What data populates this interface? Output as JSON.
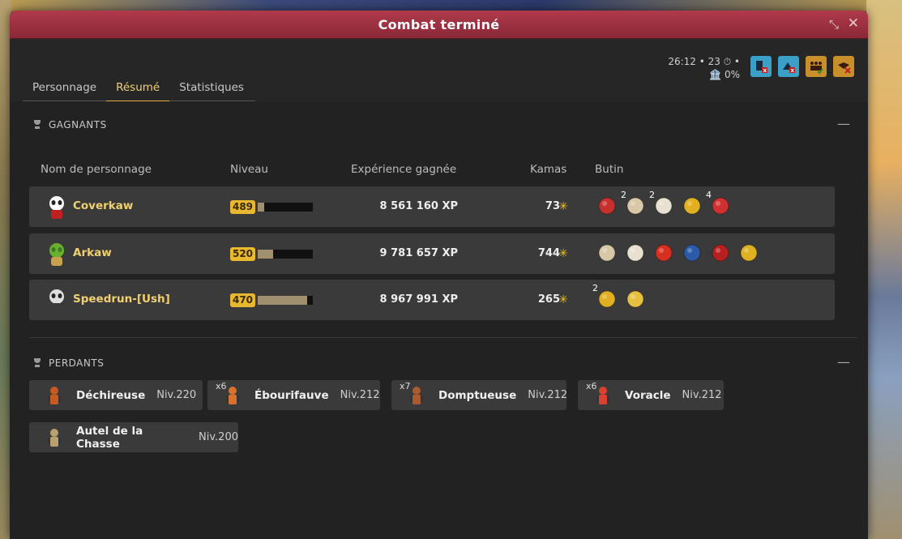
{
  "window": {
    "title": "Combat terminé"
  },
  "tabs": [
    {
      "label": "Personnage"
    },
    {
      "label": "Résumé"
    },
    {
      "label": "Statistiques"
    }
  ],
  "fight_info": {
    "line1": "26:12 • 23 ⏱ •",
    "line2": "🏦 0%"
  },
  "options": [
    {
      "icon": "spectator-lock-icon",
      "color": "#3aa0c8"
    },
    {
      "icon": "no-help-icon",
      "color": "#3aa0c8"
    },
    {
      "icon": "group-only-icon",
      "color": "#c8902a"
    },
    {
      "icon": "no-challenge-icon",
      "color": "#c8902a"
    }
  ],
  "winners": {
    "heading": "GAGNANTS",
    "columns": {
      "name": "Nom de personnage",
      "level": "Niveau",
      "xp": "Expérience gagnée",
      "kamas": "Kamas",
      "loot": "Butin"
    },
    "rows": [
      {
        "name": "Coverkaw",
        "level": "489",
        "level_progress": 0.12,
        "xp": "8 561 160 XP",
        "kamas": "73",
        "loot": [
          {
            "icon": "red-scale-icon",
            "qty": "",
            "color": "#c83030"
          },
          {
            "icon": "feather-fan-icon",
            "qty": "2",
            "color": "#d8c8a8"
          },
          {
            "icon": "paper-scroll-icon",
            "qty": "2",
            "color": "#e8e0d0"
          },
          {
            "icon": "gold-orb-icon",
            "qty": "",
            "color": "#e0b020"
          },
          {
            "icon": "red-dragon-icon",
            "qty": "4",
            "color": "#d03030"
          }
        ]
      },
      {
        "name": "Arkaw",
        "level": "520",
        "level_progress": 0.28,
        "xp": "9 781 657 XP",
        "kamas": "744",
        "loot": [
          {
            "icon": "feather-fan-icon",
            "qty": "",
            "color": "#d8c8a8"
          },
          {
            "icon": "paper-scroll-icon",
            "qty": "",
            "color": "#e8e0d0"
          },
          {
            "icon": "red-apple-icon",
            "qty": "",
            "color": "#d83020"
          },
          {
            "icon": "blue-pot-icon",
            "qty": "",
            "color": "#2a5aa8"
          },
          {
            "icon": "red-wing-icon",
            "qty": "",
            "color": "#b82020"
          },
          {
            "icon": "gold-orb-icon",
            "qty": "",
            "color": "#e0b020"
          }
        ]
      },
      {
        "name": "Speedrun-[Ush]",
        "level": "470",
        "level_progress": 0.9,
        "xp": "8 967 991 XP",
        "kamas": "265",
        "loot": [
          {
            "icon": "gold-orb-icon",
            "qty": "2",
            "color": "#e0b020"
          },
          {
            "icon": "yellow-horn-icon",
            "qty": "",
            "color": "#e8c040"
          }
        ]
      }
    ]
  },
  "losers": {
    "heading": "PERDANTS",
    "rows": [
      {
        "name": "Déchireuse",
        "level": "Niv.220",
        "qty": "",
        "icon": "dechireuse-icon"
      },
      {
        "name": "Ébourifauve",
        "level": "Niv.212",
        "qty": "x6",
        "icon": "ebourifauve-icon"
      },
      {
        "name": "Domptueuse",
        "level": "Niv.212",
        "qty": "x7",
        "icon": "domptueuse-icon"
      },
      {
        "name": "Voracle",
        "level": "Niv.212",
        "qty": "x6",
        "icon": "voracle-icon"
      },
      {
        "name": "Autel de la Chasse",
        "level": "Niv.200",
        "qty": "",
        "icon": "autel-icon"
      }
    ]
  }
}
